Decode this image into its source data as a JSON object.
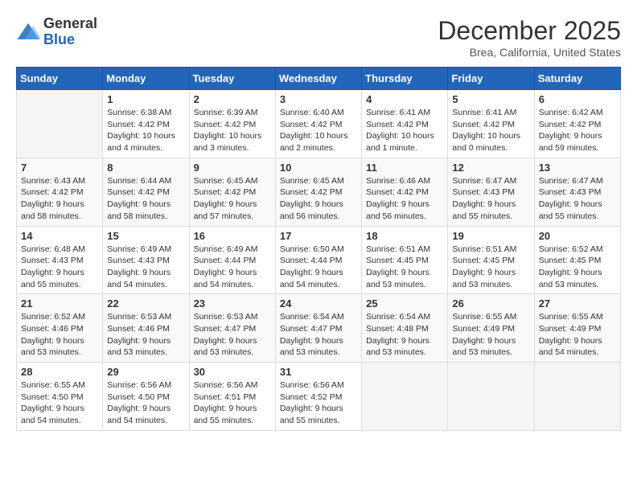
{
  "header": {
    "logo_general": "General",
    "logo_blue": "Blue",
    "title": "December 2025",
    "location": "Brea, California, United States"
  },
  "calendar": {
    "days_of_week": [
      "Sunday",
      "Monday",
      "Tuesday",
      "Wednesday",
      "Thursday",
      "Friday",
      "Saturday"
    ],
    "weeks": [
      [
        {
          "day": "",
          "info": ""
        },
        {
          "day": "1",
          "info": "Sunrise: 6:38 AM\nSunset: 4:42 PM\nDaylight: 10 hours\nand 4 minutes."
        },
        {
          "day": "2",
          "info": "Sunrise: 6:39 AM\nSunset: 4:42 PM\nDaylight: 10 hours\nand 3 minutes."
        },
        {
          "day": "3",
          "info": "Sunrise: 6:40 AM\nSunset: 4:42 PM\nDaylight: 10 hours\nand 2 minutes."
        },
        {
          "day": "4",
          "info": "Sunrise: 6:41 AM\nSunset: 4:42 PM\nDaylight: 10 hours\nand 1 minute."
        },
        {
          "day": "5",
          "info": "Sunrise: 6:41 AM\nSunset: 4:42 PM\nDaylight: 10 hours\nand 0 minutes."
        },
        {
          "day": "6",
          "info": "Sunrise: 6:42 AM\nSunset: 4:42 PM\nDaylight: 9 hours\nand 59 minutes."
        }
      ],
      [
        {
          "day": "7",
          "info": "Sunrise: 6:43 AM\nSunset: 4:42 PM\nDaylight: 9 hours\nand 58 minutes."
        },
        {
          "day": "8",
          "info": "Sunrise: 6:44 AM\nSunset: 4:42 PM\nDaylight: 9 hours\nand 58 minutes."
        },
        {
          "day": "9",
          "info": "Sunrise: 6:45 AM\nSunset: 4:42 PM\nDaylight: 9 hours\nand 57 minutes."
        },
        {
          "day": "10",
          "info": "Sunrise: 6:45 AM\nSunset: 4:42 PM\nDaylight: 9 hours\nand 56 minutes."
        },
        {
          "day": "11",
          "info": "Sunrise: 6:46 AM\nSunset: 4:42 PM\nDaylight: 9 hours\nand 56 minutes."
        },
        {
          "day": "12",
          "info": "Sunrise: 6:47 AM\nSunset: 4:43 PM\nDaylight: 9 hours\nand 55 minutes."
        },
        {
          "day": "13",
          "info": "Sunrise: 6:47 AM\nSunset: 4:43 PM\nDaylight: 9 hours\nand 55 minutes."
        }
      ],
      [
        {
          "day": "14",
          "info": "Sunrise: 6:48 AM\nSunset: 4:43 PM\nDaylight: 9 hours\nand 55 minutes."
        },
        {
          "day": "15",
          "info": "Sunrise: 6:49 AM\nSunset: 4:43 PM\nDaylight: 9 hours\nand 54 minutes."
        },
        {
          "day": "16",
          "info": "Sunrise: 6:49 AM\nSunset: 4:44 PM\nDaylight: 9 hours\nand 54 minutes."
        },
        {
          "day": "17",
          "info": "Sunrise: 6:50 AM\nSunset: 4:44 PM\nDaylight: 9 hours\nand 54 minutes."
        },
        {
          "day": "18",
          "info": "Sunrise: 6:51 AM\nSunset: 4:45 PM\nDaylight: 9 hours\nand 53 minutes."
        },
        {
          "day": "19",
          "info": "Sunrise: 6:51 AM\nSunset: 4:45 PM\nDaylight: 9 hours\nand 53 minutes."
        },
        {
          "day": "20",
          "info": "Sunrise: 6:52 AM\nSunset: 4:45 PM\nDaylight: 9 hours\nand 53 minutes."
        }
      ],
      [
        {
          "day": "21",
          "info": "Sunrise: 6:52 AM\nSunset: 4:46 PM\nDaylight: 9 hours\nand 53 minutes."
        },
        {
          "day": "22",
          "info": "Sunrise: 6:53 AM\nSunset: 4:46 PM\nDaylight: 9 hours\nand 53 minutes."
        },
        {
          "day": "23",
          "info": "Sunrise: 6:53 AM\nSunset: 4:47 PM\nDaylight: 9 hours\nand 53 minutes."
        },
        {
          "day": "24",
          "info": "Sunrise: 6:54 AM\nSunset: 4:47 PM\nDaylight: 9 hours\nand 53 minutes."
        },
        {
          "day": "25",
          "info": "Sunrise: 6:54 AM\nSunset: 4:48 PM\nDaylight: 9 hours\nand 53 minutes."
        },
        {
          "day": "26",
          "info": "Sunrise: 6:55 AM\nSunset: 4:49 PM\nDaylight: 9 hours\nand 53 minutes."
        },
        {
          "day": "27",
          "info": "Sunrise: 6:55 AM\nSunset: 4:49 PM\nDaylight: 9 hours\nand 54 minutes."
        }
      ],
      [
        {
          "day": "28",
          "info": "Sunrise: 6:55 AM\nSunset: 4:50 PM\nDaylight: 9 hours\nand 54 minutes."
        },
        {
          "day": "29",
          "info": "Sunrise: 6:56 AM\nSunset: 4:50 PM\nDaylight: 9 hours\nand 54 minutes."
        },
        {
          "day": "30",
          "info": "Sunrise: 6:56 AM\nSunset: 4:51 PM\nDaylight: 9 hours\nand 55 minutes."
        },
        {
          "day": "31",
          "info": "Sunrise: 6:56 AM\nSunset: 4:52 PM\nDaylight: 9 hours\nand 55 minutes."
        },
        {
          "day": "",
          "info": ""
        },
        {
          "day": "",
          "info": ""
        },
        {
          "day": "",
          "info": ""
        }
      ]
    ]
  }
}
